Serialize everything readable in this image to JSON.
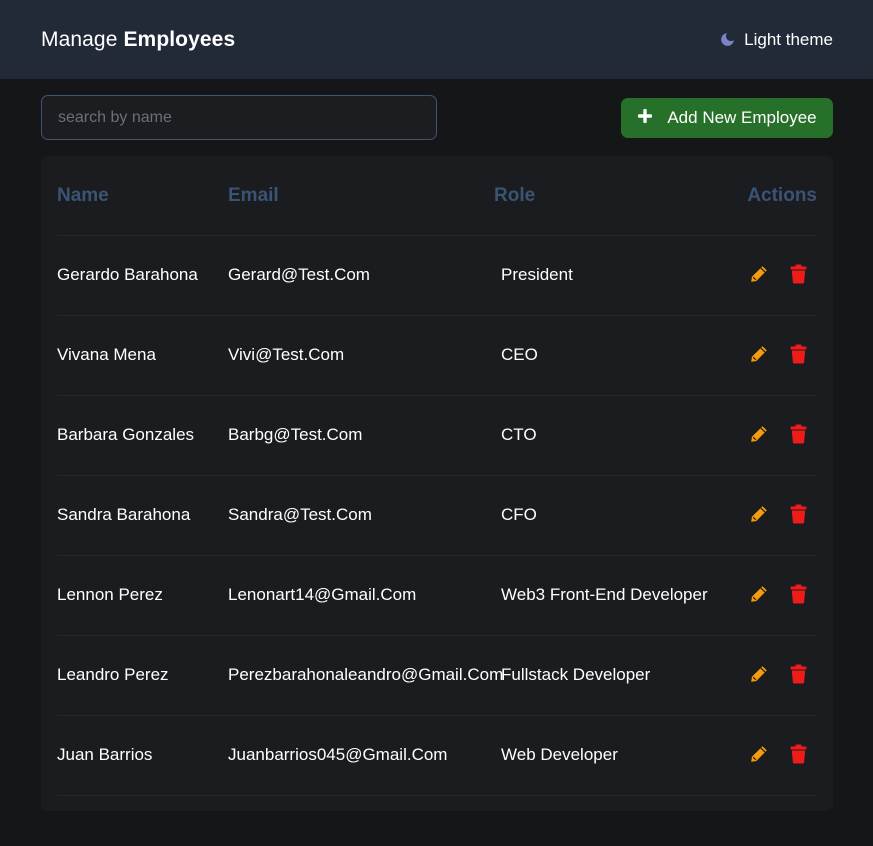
{
  "header": {
    "title_prefix": "Manage",
    "title_bold": "Employees",
    "theme_toggle_label": "Light theme",
    "theme_icon": "moon-icon"
  },
  "search": {
    "placeholder": "search by name",
    "value": ""
  },
  "add_button": {
    "label": "Add New Employee",
    "icon": "plus-icon"
  },
  "table": {
    "columns": [
      "Name",
      "Email",
      "Role",
      "Actions"
    ],
    "rows": [
      {
        "name": "Gerardo Barahona",
        "email": "Gerard@Test.Com",
        "role": "President"
      },
      {
        "name": "Vivana Mena",
        "email": "Vivi@Test.Com",
        "role": "CEO"
      },
      {
        "name": "Barbara Gonzales",
        "email": "Barbg@Test.Com",
        "role": "CTO"
      },
      {
        "name": "Sandra Barahona",
        "email": "Sandra@Test.Com",
        "role": "CFO"
      },
      {
        "name": "Lennon Perez",
        "email": "Lenonart14@Gmail.Com",
        "role": "Web3 Front-End Developer"
      },
      {
        "name": "Leandro Perez",
        "email": "Perezbarahonaleandro@Gmail.Com",
        "role": "Fullstack Developer"
      },
      {
        "name": "Juan Barrios",
        "email": "Juanbarrios045@Gmail.Com",
        "role": "Web Developer"
      }
    ],
    "row_actions": {
      "edit_icon": "pencil-icon",
      "delete_icon": "trash-icon"
    }
  },
  "colors": {
    "header_bg": "#222937",
    "page_bg": "#151618",
    "card_bg": "#1b1c1f",
    "column_header": "#3b5374",
    "add_button_bg": "#27702a",
    "edit_icon": "#f59e0b",
    "delete_icon": "#ef1a1a",
    "moon_icon": "#7b82c9"
  }
}
